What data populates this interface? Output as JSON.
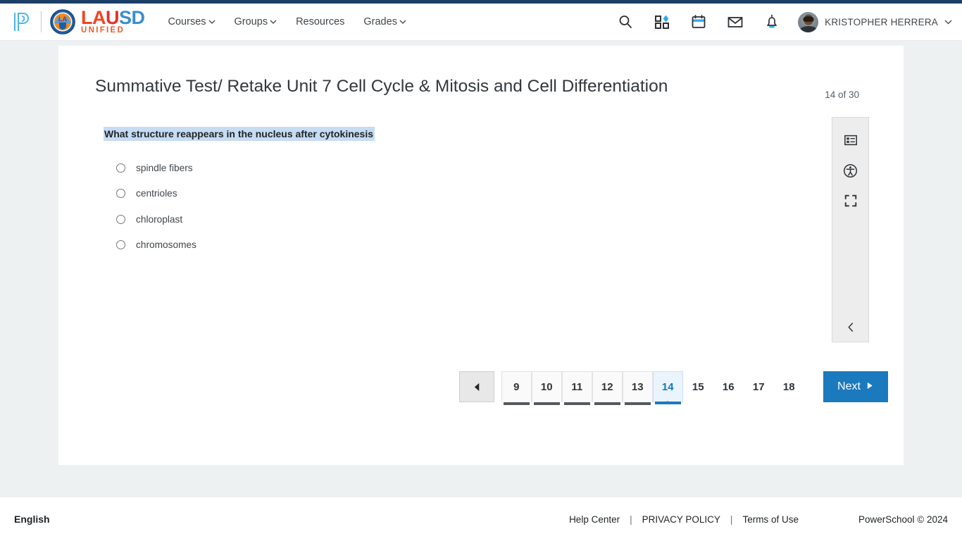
{
  "header": {
    "brand": {
      "powerschool_icon": "powerschool-p-logo",
      "seal_icon": "lausd-seal",
      "word_la": "LA",
      "word_u": "U",
      "word_sd": "SD",
      "word_sub": "UNIFIED"
    },
    "nav": [
      {
        "label": "Courses",
        "has_caret": true
      },
      {
        "label": "Groups",
        "has_caret": true
      },
      {
        "label": "Resources",
        "has_caret": false
      },
      {
        "label": "Grades",
        "has_caret": true
      }
    ],
    "icons": [
      {
        "name": "search-icon"
      },
      {
        "name": "apps-grid-icon"
      },
      {
        "name": "calendar-icon"
      },
      {
        "name": "mail-icon"
      },
      {
        "name": "notifications-bell-icon"
      }
    ],
    "user": {
      "name": "KRISTOPHER HERRERA",
      "avatar": "user-avatar"
    }
  },
  "quiz": {
    "title": "Summative Test/ Retake Unit 7 Cell Cycle & Mitosis and Cell Differentiation",
    "progress": "14 of 30",
    "question": "What structure reappears in the nucleus after cytokinesis",
    "options": [
      {
        "label": "spindle fibers",
        "selected": false
      },
      {
        "label": "centrioles",
        "selected": false
      },
      {
        "label": "chloroplast",
        "selected": false
      },
      {
        "label": "chromosomes",
        "selected": false
      }
    ]
  },
  "tool_rail": {
    "buttons": [
      {
        "name": "question-list-icon"
      },
      {
        "name": "accessibility-icon"
      },
      {
        "name": "fullscreen-icon"
      }
    ],
    "collapse": {
      "name": "collapse-rail-icon"
    }
  },
  "pagination": {
    "prev_label": "◀",
    "pages": [
      {
        "number": "9",
        "state": "answered"
      },
      {
        "number": "10",
        "state": "answered"
      },
      {
        "number": "11",
        "state": "answered"
      },
      {
        "number": "12",
        "state": "answered"
      },
      {
        "number": "13",
        "state": "answered"
      },
      {
        "number": "14",
        "state": "active"
      },
      {
        "number": "15",
        "state": "unanswered"
      },
      {
        "number": "16",
        "state": "unanswered"
      },
      {
        "number": "17",
        "state": "unanswered"
      },
      {
        "number": "18",
        "state": "unanswered"
      }
    ],
    "next_label": "Next"
  },
  "footer": {
    "language": "English",
    "links": [
      {
        "label": "Help Center"
      },
      {
        "label": "PRIVACY POLICY"
      },
      {
        "label": "Terms of Use"
      }
    ],
    "separator": "|",
    "copyright": "PowerSchool © 2024"
  },
  "colors": {
    "brand_blue": "#1b79bd",
    "navy_strip": "#1b3f66",
    "page_bg": "#eef1f2",
    "selection_highlight": "#c6dcf3",
    "lausd_orange": "#ef4623",
    "lausd_red": "#e8312a",
    "lausd_blue": "#3a8dd0"
  }
}
